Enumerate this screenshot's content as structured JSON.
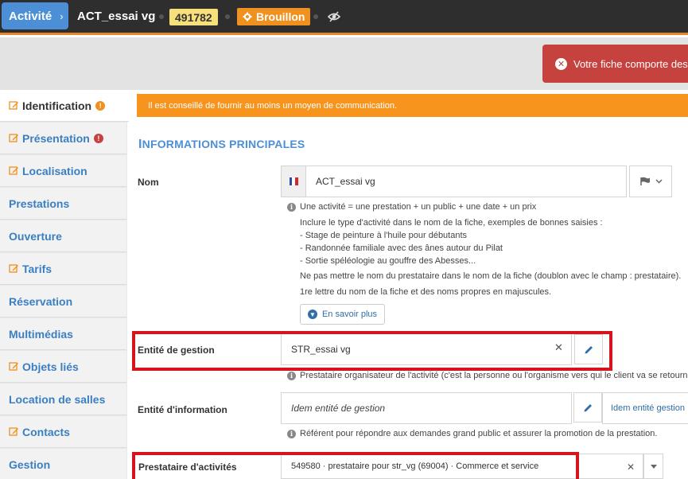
{
  "header": {
    "breadcrumb": "Activité",
    "title": "ACT_essai vg",
    "id": "491782",
    "status": "Brouillon"
  },
  "error_banner": "Votre fiche comporte des",
  "sidebar": {
    "items": [
      {
        "label": "Identification",
        "icon": "pencil-icon",
        "badge": "!"
      },
      {
        "label": "Présentation",
        "icon": "pencil-icon",
        "badge": "!"
      },
      {
        "label": "Localisation",
        "icon": "pencil-icon"
      },
      {
        "label": "Prestations"
      },
      {
        "label": "Ouverture"
      },
      {
        "label": "Tarifs",
        "icon": "pencil-icon"
      },
      {
        "label": "Réservation"
      },
      {
        "label": "Multimédias"
      },
      {
        "label": "Objets liés",
        "icon": "pencil-icon"
      },
      {
        "label": "Location de salles"
      },
      {
        "label": "Contacts",
        "icon": "pencil-icon"
      },
      {
        "label": "Gestion"
      }
    ]
  },
  "main": {
    "alert": "Il est conseillé de fournir au moins un moyen de communication.",
    "section_title_first": "I",
    "section_title_rest": "NFORMATIONS PRINCIPALES",
    "nom": {
      "label": "Nom",
      "value": "ACT_essai vg",
      "help_title": "Une activité = une prestation + un public + une date + un prix",
      "help_lines": [
        "Inclure le type d'activité dans le nom de la fiche, exemples de bonnes saisies :",
        "- Stage de peinture à l'huile pour débutants",
        "- Randonnée familiale avec des ânes autour du Pilat",
        "- Sortie spéléologie au gouffre des Abesses...",
        "Ne pas mettre le nom du prestataire dans le nom de la fiche (doublon avec le champ : prestataire).",
        "1re lettre du nom de la fiche et des noms propres en majuscules."
      ],
      "more_button": "En savoir plus"
    },
    "entite_gestion": {
      "label": "Entité de gestion",
      "value": "STR_essai vg",
      "help": "Prestataire organisateur de l'activité (c'est la personne ou l'organisme vers qui le client va se retourner e"
    },
    "entite_information": {
      "label": "Entité d'information",
      "placeholder": "Idem entité de gestion",
      "link": "Idem entité gestion",
      "help": "Référent pour répondre aux demandes grand public et assurer la promotion de la prestation."
    },
    "prestataire": {
      "label": "Prestataire d'activités",
      "value": "549580 · prestataire pour str_vg (69004) · Commerce et service"
    }
  },
  "colors": {
    "topbar": "#2e2e2e",
    "accent_blue": "#4c8fd6",
    "status_orange": "#f0901e",
    "id_yellow": "#f7e07a",
    "error_red": "#c6423f",
    "highlight_red": "#d6141b"
  }
}
